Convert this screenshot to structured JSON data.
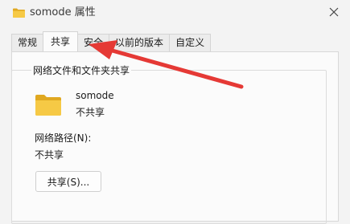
{
  "window": {
    "title": "somode 属性",
    "title_icon": "folder-icon",
    "close_icon": "close-icon"
  },
  "tabs": [
    {
      "label": "常规",
      "active": false
    },
    {
      "label": "共享",
      "active": true
    },
    {
      "label": "安全",
      "active": false
    },
    {
      "label": "以前的版本",
      "active": false
    },
    {
      "label": "自定义",
      "active": false
    }
  ],
  "sharing": {
    "group_title": "网络文件和文件夹共享",
    "folder_icon": "folder-icon",
    "folder_name": "somode",
    "status": "不共享",
    "network_path_label": "网络路径(N):",
    "network_path_value": "不共享",
    "share_button": "共享(S)..."
  },
  "annotation": {
    "type": "arrow",
    "color": "#e53935",
    "points_to": "tab-sharing"
  },
  "colors": {
    "folder": "#f4c542",
    "folder_dark": "#e0a820",
    "arrow": "#e53935"
  }
}
